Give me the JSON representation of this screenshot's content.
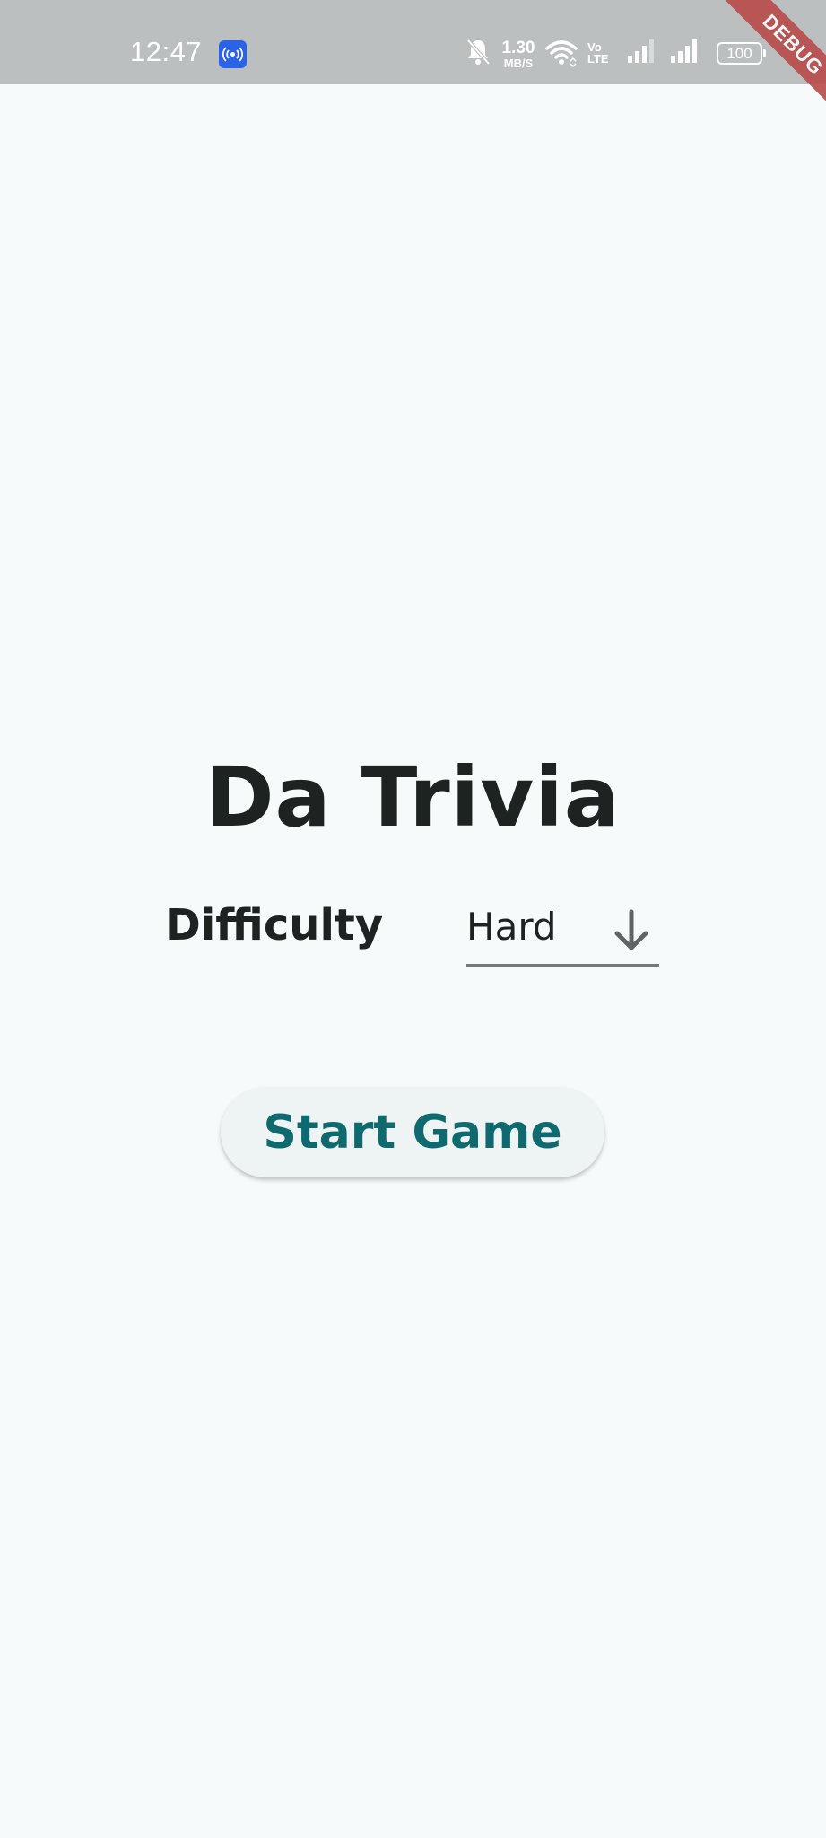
{
  "status_bar": {
    "time": "12:47",
    "net_speed_value": "1.30",
    "net_speed_unit": "MB/S",
    "volte_label": "Vo LTE",
    "battery": "100",
    "icons": [
      "hotspot-icon",
      "bell-off-icon",
      "wifi-icon",
      "signal-icon",
      "signal-icon",
      "battery-icon"
    ]
  },
  "debug_banner": "DEBUG",
  "app": {
    "title": "Da Trivia",
    "difficulty_label": "Difficulty",
    "difficulty_value": "Hard",
    "start_button_label": "Start Game"
  },
  "colors": {
    "background": "#f6fafa",
    "status_bar": "#bcbfbf",
    "text_dark": "#1c2321",
    "accent_teal": "#0f6a70",
    "debug_red": "#b84a4a"
  }
}
